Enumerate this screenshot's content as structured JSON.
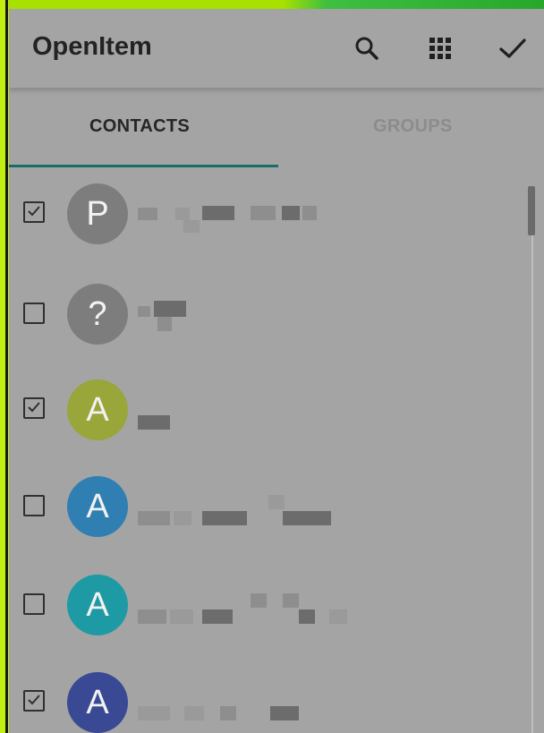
{
  "app": {
    "title": "OpenItem"
  },
  "toolbar": {
    "icons": [
      "search-icon",
      "dialpad-grid-icon",
      "checkmark-icon"
    ]
  },
  "tabs": [
    {
      "label": "CONTACTS",
      "selected": true
    },
    {
      "label": "GROUPS",
      "selected": false
    }
  ],
  "contacts": [
    {
      "initial": "P",
      "checked": true,
      "avatar_color": "#7d7d7d"
    },
    {
      "initial": "?",
      "checked": false,
      "avatar_color": "#7d7d7d"
    },
    {
      "initial": "A",
      "checked": true,
      "avatar_color": "#99a63a"
    },
    {
      "initial": "A",
      "checked": false,
      "avatar_color": "#2f7fb3"
    },
    {
      "initial": "A",
      "checked": false,
      "avatar_color": "#1e9aa4"
    },
    {
      "initial": "A",
      "checked": true,
      "avatar_color": "#3a4994"
    }
  ]
}
